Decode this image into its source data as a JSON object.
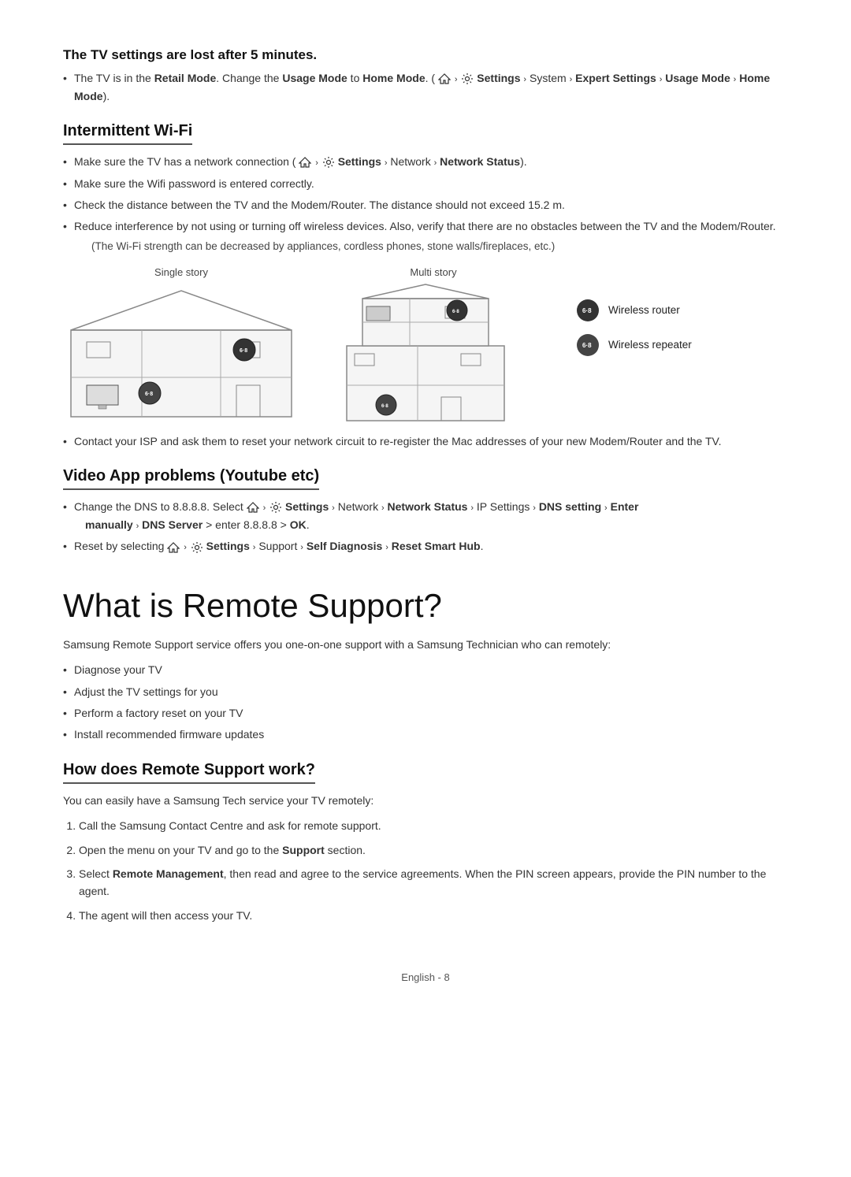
{
  "sections": {
    "tv_settings_lost": {
      "heading": "The TV settings are lost after 5 minutes.",
      "bullet1_prefix": "The TV is in the ",
      "bullet1_retail": "Retail Mode",
      "bullet1_mid": ". Change the ",
      "bullet1_usage": "Usage Mode",
      "bullet1_mid2": " to ",
      "bullet1_home": "Home Mode",
      "bullet1_mid3": ". (",
      "bullet1_path": "Settings > System > Expert Settings > Usage Mode > Home Mode",
      "bullet1_suffix": ")."
    },
    "intermittent_wifi": {
      "heading": "Intermittent Wi-Fi",
      "bullet1_prefix": "Make sure the TV has a network connection (",
      "bullet1_path": "Settings > Network > Network Status",
      "bullet1_suffix": ").",
      "bullet2": "Make sure the Wifi password is entered correctly.",
      "bullet3": "Check the distance between the TV and the Modem/Router. The distance should not exceed 15.2 m.",
      "bullet4": "Reduce interference by not using or turning off wireless devices. Also, verify that there are no obstacles between the TV and the Modem/Router.",
      "note": "(The Wi-Fi strength can be decreased by appliances, cordless phones, stone walls/fireplaces, etc.)",
      "single_story_label": "Single story",
      "multi_story_label": "Multi story",
      "wireless_router_label": "Wireless router",
      "wireless_repeater_label": "Wireless repeater",
      "bullet5_prefix": "Contact your ISP and ask them to reset your network circuit to re-register the Mac addresses of your new Modem/Router and the TV."
    },
    "video_app_problems": {
      "heading": "Video App problems (Youtube etc)",
      "bullet1_prefix": "Change the DNS to 8.8.8.8. Select ",
      "bullet1_path": "Settings > Network > Network Status > IP Settings > DNS setting > Enter manually > DNS Server",
      "bullet1_suffix": " > enter 8.8.8.8 > ",
      "bullet1_ok": "OK",
      "bullet1_end": ".",
      "bullet2_prefix": "Reset by selecting ",
      "bullet2_path": "Settings > Support > Self Diagnosis > Reset Smart Hub",
      "bullet2_suffix": "."
    },
    "remote_support": {
      "main_heading": "What is Remote Support?",
      "intro": "Samsung Remote Support service offers you one-on-one support with a Samsung Technician who can remotely:",
      "bullets": [
        "Diagnose your TV",
        "Adjust the TV settings for you",
        "Perform a factory reset on your TV",
        "Install recommended firmware updates"
      ],
      "how_heading": "How does Remote Support work?",
      "how_intro": "You can easily have a Samsung Tech service your TV remotely:",
      "steps": [
        "Call the Samsung Contact Centre and ask for remote support.",
        "Open the menu on your TV and go to the Support section.",
        "Select Remote Management, then read and agree to the service agreements. When the PIN screen appears, provide the PIN number to the agent.",
        "The agent will then access your TV."
      ]
    },
    "footer": {
      "text": "English - 8"
    }
  },
  "icons": {
    "home": "⌂",
    "settings": "⚙",
    "arrow": "›"
  }
}
